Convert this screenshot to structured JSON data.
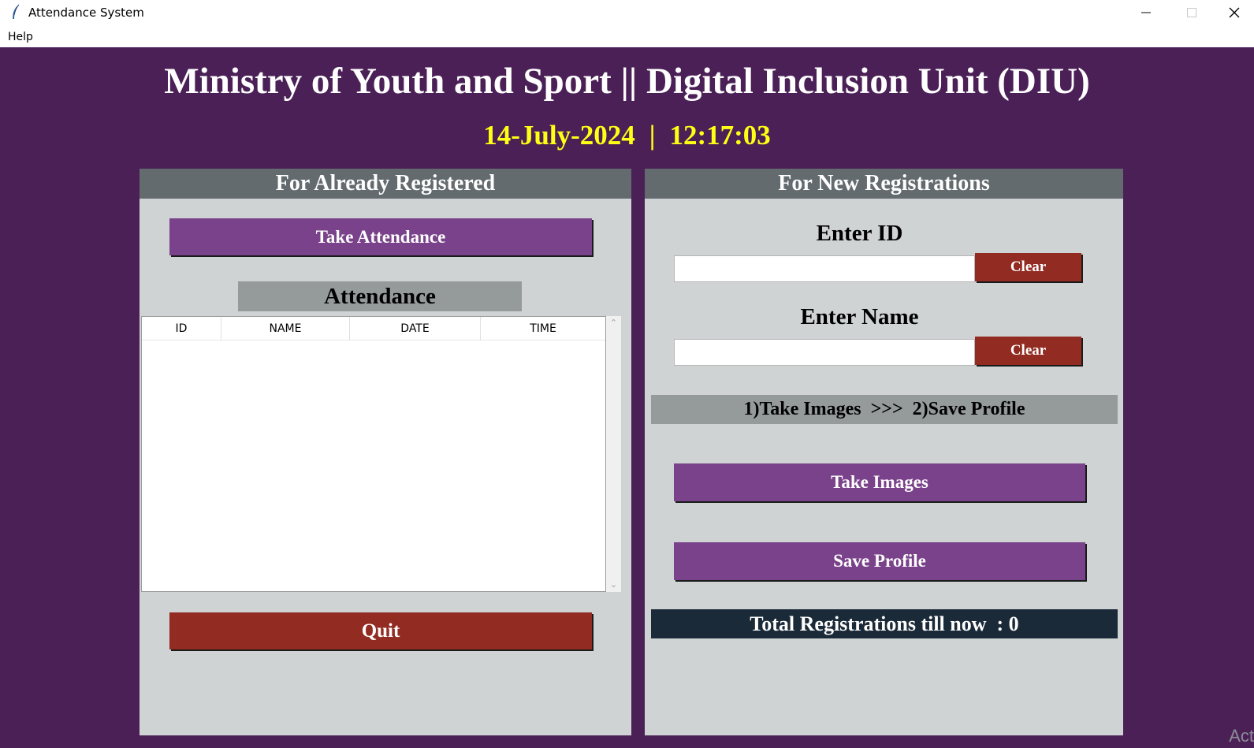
{
  "window": {
    "title": "Attendance System",
    "icon": "feather-icon",
    "controls": [
      "minimize-icon",
      "maximize-icon",
      "close-icon"
    ]
  },
  "menu": {
    "items": [
      "Help"
    ]
  },
  "header": {
    "title": "Ministry of Youth and Sport || Digital Inclusion Unit (DIU)",
    "date": "14-July-2024",
    "separator": "|",
    "time": "12:17:03"
  },
  "left_panel": {
    "title": "For Already Registered",
    "take_attendance_label": "Take Attendance",
    "attendance_label": "Attendance",
    "table": {
      "columns": [
        "ID",
        "NAME",
        "DATE",
        "TIME"
      ],
      "rows": []
    },
    "quit_label": "Quit"
  },
  "right_panel": {
    "title": "For New Registrations",
    "id_label": "Enter ID",
    "id_value": "",
    "name_label": "Enter Name",
    "name_value": "",
    "clear_label": "Clear",
    "steps_text": "1)Take Images  >>>  2)Save Profile",
    "take_images_label": "Take Images",
    "save_profile_label": "Save Profile",
    "total_text": "Total Registrations till now  : 0"
  },
  "watermark": "Act",
  "colors": {
    "background": "#4b2057",
    "panel": "#d0d3d4",
    "panel_header": "#636b6f",
    "button_purple": "#7a428a",
    "button_red": "#922b21",
    "datetime": "#ffff14",
    "total_bar": "#1b2a38"
  }
}
